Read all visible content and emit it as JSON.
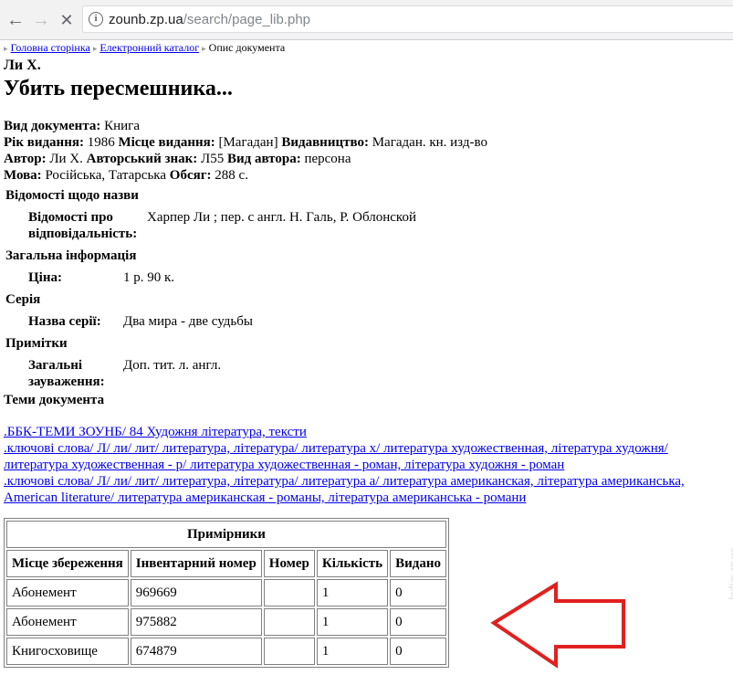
{
  "browser": {
    "url_domain": "zounb.zp.ua",
    "url_path": "/search/page_lib.php",
    "icons": {
      "back": "arrow-left-icon",
      "forward": "arrow-right-icon",
      "stop": "close-icon",
      "info": "info-icon"
    }
  },
  "breadcrumb": {
    "home": "Головна сторінка",
    "catalog": "Електронний каталог",
    "current": "Опис документа"
  },
  "doc": {
    "author": "Ли Х.",
    "title": "Убить пересмешника..."
  },
  "meta": {
    "doc_type_label": "Вид документа:",
    "doc_type": "Книга",
    "year_label": "Рік видання:",
    "year": "1986",
    "place_label": "Місце видання:",
    "place": "[Магадан]",
    "publisher_label": "Видавництво:",
    "publisher": "Магадан. кн. изд-во",
    "author_label": "Автор:",
    "author": "Ли Х.",
    "author_sign_label": "Авторський знак:",
    "author_sign": "Л55",
    "author_type_label": "Вид автора:",
    "author_type": "персона",
    "language_label": "Мова:",
    "language": "Російська, Татарська",
    "volume_label": "Обсяг:",
    "volume": "288 с."
  },
  "sections": {
    "title_info": "Відомості щодо назви",
    "responsibility_label": "Відомості про відповідальність:",
    "responsibility": "Харпер Ли ; пер. с англ. Н. Галь, Р. Облонской",
    "general": "Загальна інформація",
    "price_label": "Ціна:",
    "price": "1 р. 90 к.",
    "series": "Серія",
    "series_name_label": "Назва серії:",
    "series_name": "Два мира - две судьбы",
    "notes": "Примітки",
    "general_notes_label": "Загальні зауваження:",
    "general_notes": "Доп. тит. л. англ.",
    "topics": "Теми документа"
  },
  "topics": [
    ".ББК-ТЕМИ ЗОУНБ/ 84 Художня література, тексти",
    ".ключові слова/ Л/ ли/ лит/ литература, література/ литература х/ литература художественная, література художня/ литература художественная - р/ литература художественная - роман, література художня - роман",
    ".ключові слова/ Л/ ли/ лит/ литература, література/ литература а/ литература американская, література американська, American literature/ литература американская - романы, література американська - романи"
  ],
  "copies": {
    "caption": "Примірники",
    "headers": [
      "Місце збереження",
      "Інвентарний номер",
      "Номер",
      "Кількість",
      "Видано"
    ],
    "rows": [
      [
        "Абонемент",
        "969669",
        "",
        "1",
        "0"
      ],
      [
        "Абонемент",
        "975882",
        "",
        "1",
        "0"
      ],
      [
        "Книгосховище",
        "674879",
        "",
        "1",
        "0"
      ]
    ]
  },
  "annotation": {
    "arrow_color": "#e0201f",
    "icon": "arrow-left-icon"
  },
  "watermark": "ladies.zp.ua"
}
